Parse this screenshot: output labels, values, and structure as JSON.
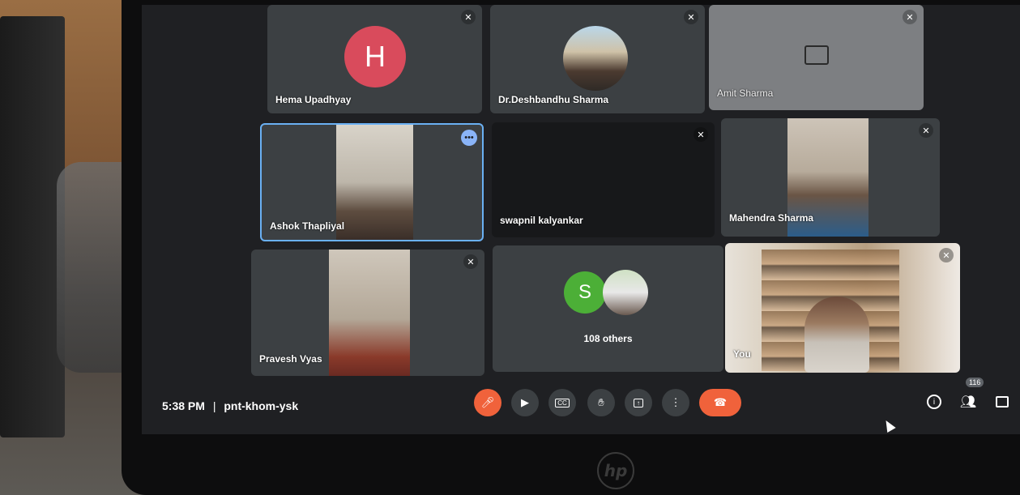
{
  "participants": [
    {
      "name": "Hema Upadhyay",
      "initial": "H",
      "avatar_color": "#d94b5c"
    },
    {
      "name": "Dr.Deshbandhu Sharma"
    },
    {
      "name": "Amit Sharma"
    },
    {
      "name": "Ashok Thapliyal"
    },
    {
      "name": "swapnil kalyankar"
    },
    {
      "name": "Mahendra Sharma"
    },
    {
      "name": "Pravesh Vyas"
    },
    {
      "name": "108 others",
      "initial": "S",
      "avatar_color": "#4caf37"
    },
    {
      "name": "You"
    }
  ],
  "footer": {
    "time": "5:38 PM",
    "separator": "|",
    "meeting_code": "pnt-khom-ysk",
    "participant_count": "116"
  },
  "colors": {
    "tile_bg": "#3c4043",
    "active_border": "#6ab0f3",
    "mic_off_red": "#ea4335",
    "leave_red": "#f0623b"
  },
  "icons": [
    "mic-off-icon",
    "camera-icon",
    "captions-icon",
    "raise-hand-icon",
    "present-icon",
    "more-options-icon",
    "leave-call-icon",
    "info-icon",
    "people-icon",
    "chat-icon"
  ],
  "bezel": {
    "logo": "hp"
  }
}
